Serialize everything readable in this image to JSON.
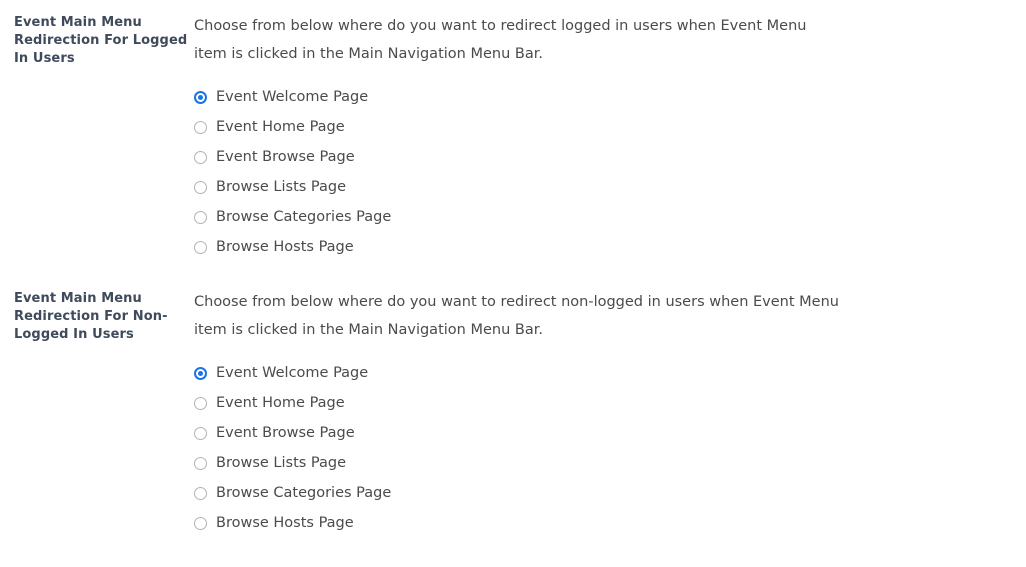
{
  "theme": {
    "page_background": "#ffffff",
    "heading_color": "#3f4b5b",
    "body_text_color": "#4b4b4b",
    "radio_accent_color": "#1a73e8",
    "radio_border_color": "#b3b3b3"
  },
  "settings": [
    {
      "label": "Event Main Menu Redirection For Logged In Users",
      "description": "Choose from below where do you want to redirect logged in users when Event Menu item is clicked in the Main Navigation Menu Bar.",
      "selected": "Event Welcome Page",
      "options": [
        {
          "label": "Event Welcome Page",
          "checked": true
        },
        {
          "label": "Event Home Page",
          "checked": false
        },
        {
          "label": "Event Browse Page",
          "checked": false
        },
        {
          "label": "Browse Lists Page",
          "checked": false
        },
        {
          "label": "Browse Categories Page",
          "checked": false
        },
        {
          "label": "Browse Hosts Page",
          "checked": false
        }
      ]
    },
    {
      "label": "Event Main Menu Redirection For Non-Logged In Users",
      "description": "Choose from below where do you want to redirect non-logged in users when Event Menu item is clicked in the Main Navigation Menu Bar.",
      "selected": "Event Welcome Page",
      "options": [
        {
          "label": "Event Welcome Page",
          "checked": true
        },
        {
          "label": "Event Home Page",
          "checked": false
        },
        {
          "label": "Event Browse Page",
          "checked": false
        },
        {
          "label": "Browse Lists Page",
          "checked": false
        },
        {
          "label": "Browse Categories Page",
          "checked": false
        },
        {
          "label": "Browse Hosts Page",
          "checked": false
        }
      ]
    }
  ]
}
